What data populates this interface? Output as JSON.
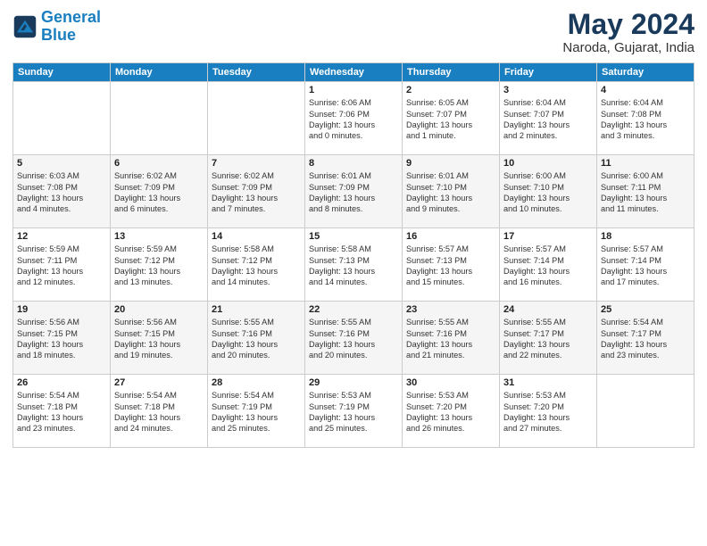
{
  "logo": {
    "line1": "General",
    "line2": "Blue"
  },
  "title": "May 2024",
  "subtitle": "Naroda, Gujarat, India",
  "days_header": [
    "Sunday",
    "Monday",
    "Tuesday",
    "Wednesday",
    "Thursday",
    "Friday",
    "Saturday"
  ],
  "weeks": [
    [
      {
        "day": "",
        "info": ""
      },
      {
        "day": "",
        "info": ""
      },
      {
        "day": "",
        "info": ""
      },
      {
        "day": "1",
        "info": "Sunrise: 6:06 AM\nSunset: 7:06 PM\nDaylight: 13 hours\nand 0 minutes."
      },
      {
        "day": "2",
        "info": "Sunrise: 6:05 AM\nSunset: 7:07 PM\nDaylight: 13 hours\nand 1 minute."
      },
      {
        "day": "3",
        "info": "Sunrise: 6:04 AM\nSunset: 7:07 PM\nDaylight: 13 hours\nand 2 minutes."
      },
      {
        "day": "4",
        "info": "Sunrise: 6:04 AM\nSunset: 7:08 PM\nDaylight: 13 hours\nand 3 minutes."
      }
    ],
    [
      {
        "day": "5",
        "info": "Sunrise: 6:03 AM\nSunset: 7:08 PM\nDaylight: 13 hours\nand 4 minutes."
      },
      {
        "day": "6",
        "info": "Sunrise: 6:02 AM\nSunset: 7:09 PM\nDaylight: 13 hours\nand 6 minutes."
      },
      {
        "day": "7",
        "info": "Sunrise: 6:02 AM\nSunset: 7:09 PM\nDaylight: 13 hours\nand 7 minutes."
      },
      {
        "day": "8",
        "info": "Sunrise: 6:01 AM\nSunset: 7:09 PM\nDaylight: 13 hours\nand 8 minutes."
      },
      {
        "day": "9",
        "info": "Sunrise: 6:01 AM\nSunset: 7:10 PM\nDaylight: 13 hours\nand 9 minutes."
      },
      {
        "day": "10",
        "info": "Sunrise: 6:00 AM\nSunset: 7:10 PM\nDaylight: 13 hours\nand 10 minutes."
      },
      {
        "day": "11",
        "info": "Sunrise: 6:00 AM\nSunset: 7:11 PM\nDaylight: 13 hours\nand 11 minutes."
      }
    ],
    [
      {
        "day": "12",
        "info": "Sunrise: 5:59 AM\nSunset: 7:11 PM\nDaylight: 13 hours\nand 12 minutes."
      },
      {
        "day": "13",
        "info": "Sunrise: 5:59 AM\nSunset: 7:12 PM\nDaylight: 13 hours\nand 13 minutes."
      },
      {
        "day": "14",
        "info": "Sunrise: 5:58 AM\nSunset: 7:12 PM\nDaylight: 13 hours\nand 14 minutes."
      },
      {
        "day": "15",
        "info": "Sunrise: 5:58 AM\nSunset: 7:13 PM\nDaylight: 13 hours\nand 14 minutes."
      },
      {
        "day": "16",
        "info": "Sunrise: 5:57 AM\nSunset: 7:13 PM\nDaylight: 13 hours\nand 15 minutes."
      },
      {
        "day": "17",
        "info": "Sunrise: 5:57 AM\nSunset: 7:14 PM\nDaylight: 13 hours\nand 16 minutes."
      },
      {
        "day": "18",
        "info": "Sunrise: 5:57 AM\nSunset: 7:14 PM\nDaylight: 13 hours\nand 17 minutes."
      }
    ],
    [
      {
        "day": "19",
        "info": "Sunrise: 5:56 AM\nSunset: 7:15 PM\nDaylight: 13 hours\nand 18 minutes."
      },
      {
        "day": "20",
        "info": "Sunrise: 5:56 AM\nSunset: 7:15 PM\nDaylight: 13 hours\nand 19 minutes."
      },
      {
        "day": "21",
        "info": "Sunrise: 5:55 AM\nSunset: 7:16 PM\nDaylight: 13 hours\nand 20 minutes."
      },
      {
        "day": "22",
        "info": "Sunrise: 5:55 AM\nSunset: 7:16 PM\nDaylight: 13 hours\nand 20 minutes."
      },
      {
        "day": "23",
        "info": "Sunrise: 5:55 AM\nSunset: 7:16 PM\nDaylight: 13 hours\nand 21 minutes."
      },
      {
        "day": "24",
        "info": "Sunrise: 5:55 AM\nSunset: 7:17 PM\nDaylight: 13 hours\nand 22 minutes."
      },
      {
        "day": "25",
        "info": "Sunrise: 5:54 AM\nSunset: 7:17 PM\nDaylight: 13 hours\nand 23 minutes."
      }
    ],
    [
      {
        "day": "26",
        "info": "Sunrise: 5:54 AM\nSunset: 7:18 PM\nDaylight: 13 hours\nand 23 minutes."
      },
      {
        "day": "27",
        "info": "Sunrise: 5:54 AM\nSunset: 7:18 PM\nDaylight: 13 hours\nand 24 minutes."
      },
      {
        "day": "28",
        "info": "Sunrise: 5:54 AM\nSunset: 7:19 PM\nDaylight: 13 hours\nand 25 minutes."
      },
      {
        "day": "29",
        "info": "Sunrise: 5:53 AM\nSunset: 7:19 PM\nDaylight: 13 hours\nand 25 minutes."
      },
      {
        "day": "30",
        "info": "Sunrise: 5:53 AM\nSunset: 7:20 PM\nDaylight: 13 hours\nand 26 minutes."
      },
      {
        "day": "31",
        "info": "Sunrise: 5:53 AM\nSunset: 7:20 PM\nDaylight: 13 hours\nand 27 minutes."
      },
      {
        "day": "",
        "info": ""
      }
    ]
  ]
}
